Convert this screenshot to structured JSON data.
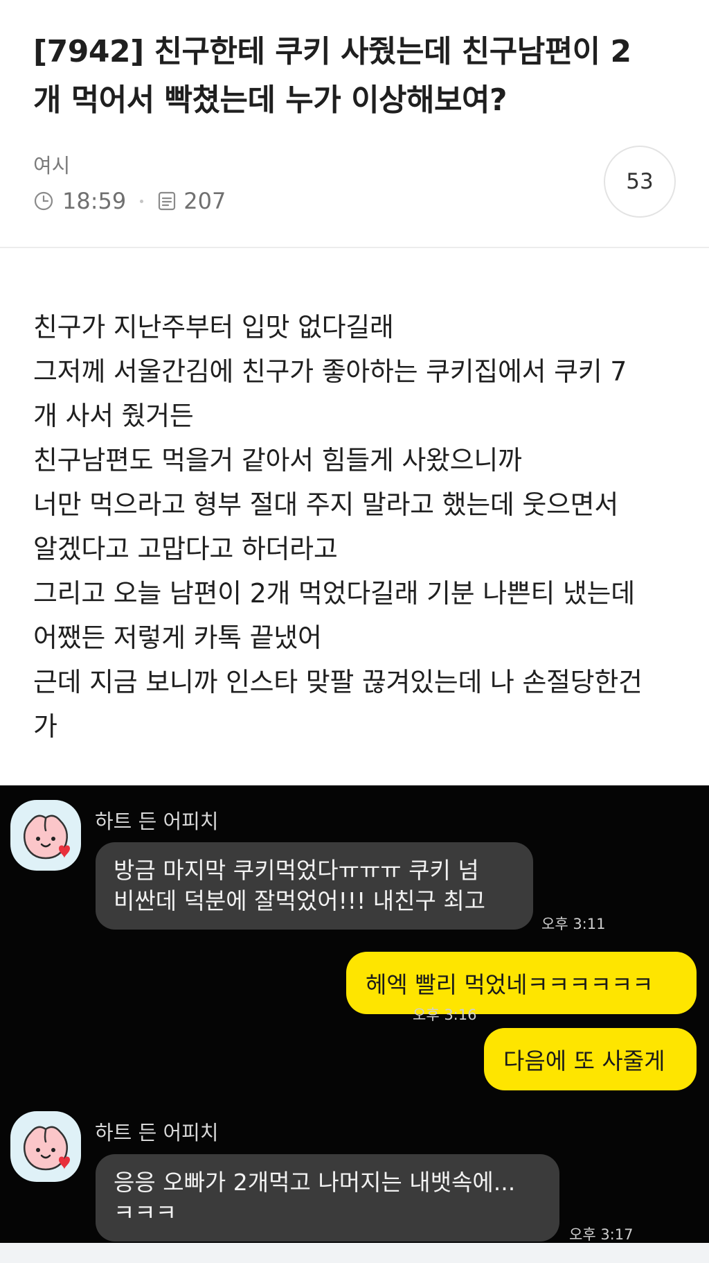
{
  "post": {
    "title": "[7942] 친구한테 쿠키 사줬는데 친구남편이 2개 먹어서 빡쳤는데 누가 이상해보여?",
    "author": "여시",
    "time": "18:59",
    "views": "207",
    "comment_count": "53",
    "body_lines": [
      "친구가 지난주부터 입맛 없다길래",
      "그저께 서울간김에 친구가 좋아하는 쿠키집에서 쿠키 7",
      "개 사서 줬거든",
      "친구남편도 먹을거 같아서 힘들게 사왔으니까",
      "너만 먹으라고 형부 절대 주지 말라고 했는데 웃으면서",
      "알겠다고 고맙다고 하더라고",
      "그리고 오늘 남편이 2개 먹었다길래 기분 나쁜티 냈는데",
      "어쨌든 저렇게 카톡 끝냈어",
      "근데 지금 보니까 인스타 맞팔 끊겨있는데 나 손절당한건",
      "가"
    ]
  },
  "chat": {
    "icons": {
      "avatar": "apeach-heart-icon"
    },
    "colors": {
      "background": "#050505",
      "incoming_bubble": "#3b3b3b",
      "outgoing_bubble": "#fee500"
    },
    "messages": [
      {
        "sender": "하트 든 어피치",
        "lines": [
          "방금 마지막 쿠키먹었다ㅠㅠㅠ 쿠키 넘",
          "비싼데 덕분에 잘먹었어!!! 내친구 최고"
        ],
        "time": "오후 3:11"
      },
      {
        "text": "헤엑 빨리 먹었네ㅋㅋㅋㅋㅋㅋ"
      },
      {
        "text": "다음에 또 사줄게",
        "time": "오후 3:16"
      },
      {
        "sender": "하트 든 어피치",
        "lines": [
          "응응 오빠가 2개먹고 나머지는 내뱃속에...",
          "ㅋㅋㅋ"
        ],
        "time": "오후 3:17"
      }
    ]
  }
}
